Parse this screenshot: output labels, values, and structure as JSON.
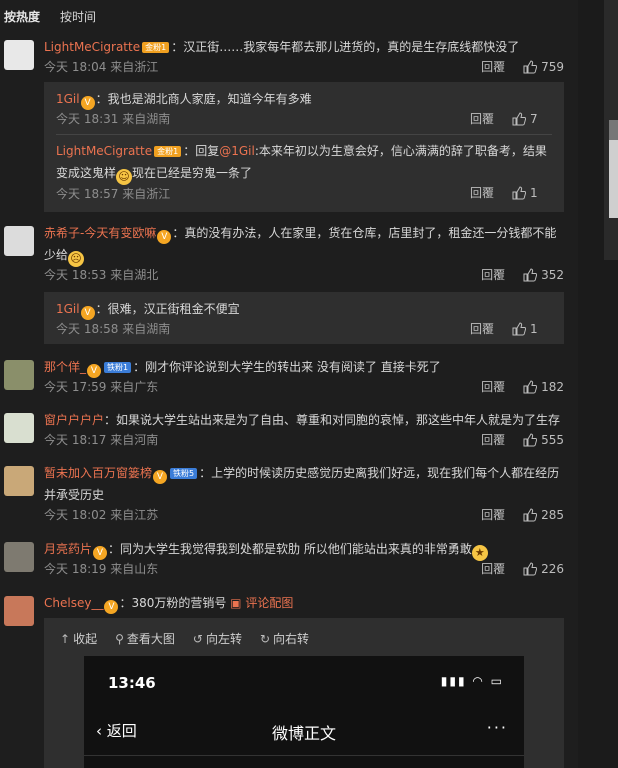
{
  "tabs": [
    {
      "label": "按热度"
    },
    {
      "label": "按时间"
    }
  ],
  "reply_label": "回覆",
  "comments": [
    {
      "user": "LightMeCigratte",
      "badge": "金粉1",
      "text": "：汉正街……我家每年都去那儿进货的，真的是生存底线都快没了",
      "time": "今天 18:04",
      "location": "来自浙江",
      "likes": "759",
      "replies": [
        {
          "user": "1Gil",
          "text": "：我也是湖北商人家庭，知道今年有多难",
          "time": "今天 18:31",
          "location": "来自湖南",
          "likes": "7"
        },
        {
          "user": "LightMeCigratte",
          "badge": "金粉1",
          "text_a": "：回复",
          "mention": "@1Gil",
          "text_b": ":本来年初以为生意会好，信心满满的辞了职备考，结果变成这鬼样",
          "text_c": "现在已经是穷鬼一条了",
          "time": "今天 18:57",
          "location": "来自浙江",
          "likes": "1"
        }
      ]
    },
    {
      "user": "赤希子-今天有变欧嘛",
      "text": "：真的没有办法，人在家里，货在仓库，店里封了，租金还一分钱都不能少给",
      "time": "今天 18:53",
      "location": "来自湖北",
      "likes": "352",
      "replies": [
        {
          "user": "1Gil",
          "text": "：很难，汉正街租金不便宜",
          "time": "今天 18:58",
          "location": "来自湖南",
          "likes": "1"
        }
      ]
    },
    {
      "user": "那个佯_",
      "badge": "铁粉1",
      "text": "：刚才你评论说到大学生的转出来 没有阅读了 直接卡死了",
      "time": "今天 17:59",
      "location": "来自广东",
      "likes": "182"
    },
    {
      "user": "窗户户户户",
      "text": "：如果说大学生站出来是为了自由、尊重和对同胞的哀悼，那这些中年人就是为了生存",
      "time": "今天 18:17",
      "location": "来自河南",
      "likes": "555"
    },
    {
      "user": "暂未加入百万窗篓榜",
      "badge": "铁粉5",
      "text": "：上学的时候读历史感觉历史离我们好远，现在我们每个人都在经历并承受历史",
      "time": "今天 18:02",
      "location": "来自江苏",
      "likes": "285"
    },
    {
      "user": "月亮药片",
      "text": "：同为大学生我觉得我到处都是软肋 所以他们能站出来真的非常勇敢",
      "time": "今天 18:19",
      "location": "来自山东",
      "likes": "226"
    },
    {
      "user": "Chelsey__",
      "text": "：380万粉的营销号",
      "pic_link": "评论配图"
    }
  ],
  "media": {
    "tools": [
      {
        "icon": "collapse-icon",
        "glyph": "↑",
        "label": "收起"
      },
      {
        "icon": "zoom-icon",
        "glyph": "⚲",
        "label": "查看大图"
      },
      {
        "icon": "rotate-left-icon",
        "glyph": "↺",
        "label": "向左转"
      },
      {
        "icon": "rotate-right-icon",
        "glyph": "↻",
        "label": "向右转"
      }
    ],
    "phone": {
      "time": "13:46",
      "status": "▮▮▮ ◠ ▭",
      "back": "返回",
      "title": "微博正文",
      "more": "···"
    }
  },
  "colors": {
    "background": "#1e1e1e",
    "username": "#eb7350",
    "subpanel": "#2f2f2f"
  }
}
